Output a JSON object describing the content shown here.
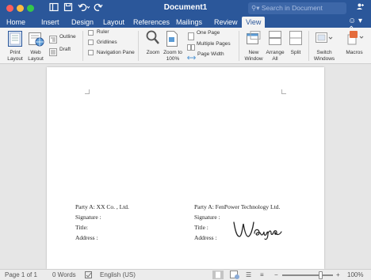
{
  "window": {
    "title": "Document1",
    "search_placeholder": "Search in Document"
  },
  "tabs": [
    {
      "label": "Home"
    },
    {
      "label": "Insert"
    },
    {
      "label": "Design"
    },
    {
      "label": "Layout"
    },
    {
      "label": "References"
    },
    {
      "label": "Mailings"
    },
    {
      "label": "Review"
    },
    {
      "label": "View",
      "active": true
    }
  ],
  "ribbon": {
    "print_layout": "Print Layout",
    "print_layout_1": "Print",
    "print_layout_2": "Layout",
    "web_layout_1": "Web",
    "web_layout_2": "Layout",
    "outline": "Outline",
    "draft": "Draft",
    "ruler": "Ruler",
    "gridlines": "Gridlines",
    "navigation_pane": "Navigation Pane",
    "zoom": "Zoom",
    "zoom_to_1": "Zoom to",
    "zoom_to_2": "100%",
    "one_page": "One Page",
    "multiple_pages": "Multiple Pages",
    "page_width": "Page Width",
    "new_window_1": "New",
    "new_window_2": "Window",
    "arrange_1": "Arrange",
    "arrange_2": "All",
    "split": "Split",
    "switch_1": "Switch",
    "switch_2": "Windows",
    "macros": "Macros"
  },
  "document": {
    "left": {
      "party": "Party A:  XX Co. ,  Ltd.",
      "signature": "Signature :",
      "title": "Title:",
      "address": "Address :"
    },
    "right": {
      "party": "Party A:  FenPower Technology Ltd.",
      "signature": "Signature :",
      "title": "Title :",
      "address": "Address :"
    },
    "handwritten_signature": "Wayne"
  },
  "status": {
    "page": "Page 1 of 1",
    "words": "0 Words",
    "language": "English (US)",
    "zoom": "100%",
    "zoom_level": 0.78
  },
  "colors": {
    "brand": "#2b579a",
    "ribbon_bg": "#f3f3f3",
    "canvas_bg": "#e6e6e6"
  }
}
